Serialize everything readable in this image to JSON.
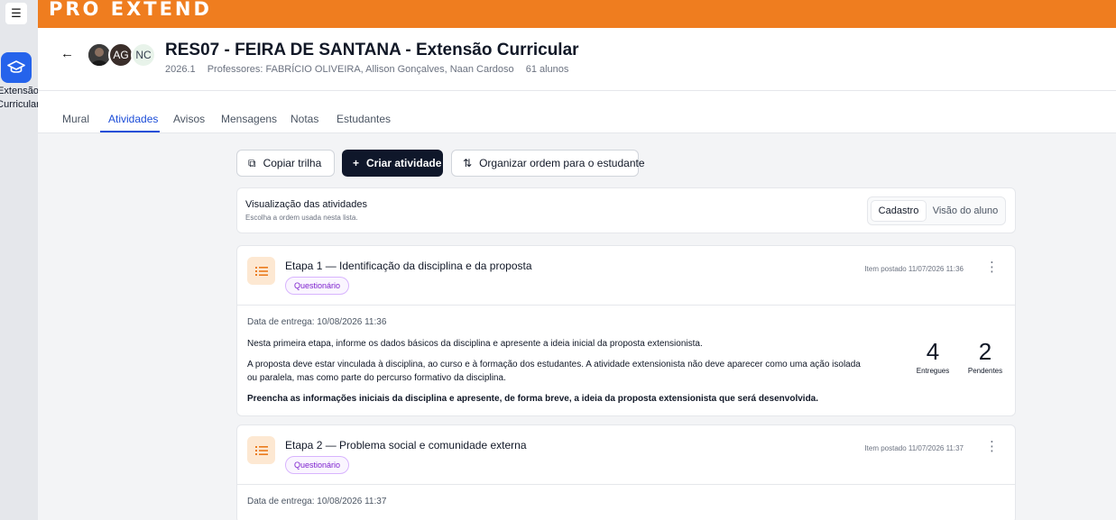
{
  "brand": {
    "name": "PRO EXTEND"
  },
  "rail": {
    "menu_icon": "hamburger-icon",
    "app_icon": "graduation-cap-icon",
    "app_label": "Extensão Curricular"
  },
  "course": {
    "title": "RES07 - FEIRA DE SANTANA - Extensão Curricular",
    "term": "2026.1",
    "professors": "Professores: FABRÍCIO OLIVEIRA, Allison Gonçalves, Naan Cardoso",
    "students": "61 alunos",
    "avatars": [
      "",
      "AG",
      "NC"
    ]
  },
  "tabs": [
    {
      "label": "Mural"
    },
    {
      "label": "Atividades",
      "active": true
    },
    {
      "label": "Avisos"
    },
    {
      "label": "Mensagens"
    },
    {
      "label": "Notas"
    },
    {
      "label": "Estudantes"
    }
  ],
  "toolbar": {
    "copy_label": "Copiar trilha",
    "create_label": "Criar atividade",
    "organize_label": "Organizar ordem para o estudante"
  },
  "view": {
    "title": "Visualização das atividades",
    "subtitle": "Escolha a ordem usada nesta lista.",
    "options": [
      "Cadastro",
      "Visão do aluno"
    ],
    "selected": "Cadastro"
  },
  "activities": [
    {
      "title": "Etapa 1 — Identificação da disciplina e da proposta",
      "badge": "Questionário",
      "posted": "Item postado 11/07/2026 11:36",
      "due": "Data de entrega: 10/08/2026 11:36",
      "desc1": "Nesta primeira etapa, informe os dados básicos da disciplina e apresente a ideia inicial da proposta extensionista.",
      "desc2": "A proposta deve estar vinculada à disciplina, ao curso e à formação dos estudantes. A atividade extensionista não deve aparecer como uma ação isolada ou paralela, mas como parte do percurso formativo da disciplina.",
      "desc3": "Preencha as informações iniciais da disciplina e apresente, de forma breve, a ideia da proposta extensionista que será desenvolvida.",
      "delivered": "4",
      "delivered_label": "Entregues",
      "pending": "2",
      "pending_label": "Pendentes"
    },
    {
      "title": "Etapa 2 — Problema social e comunidade externa",
      "badge": "Questionário",
      "posted": "Item postado 11/07/2026 11:37",
      "due": "Data de entrega: 10/08/2026 11:37"
    }
  ],
  "colors": {
    "brand": "#ef7d1f",
    "primary": "#2563eb",
    "dark_button": "#0f172a",
    "badge": "#7e22ce"
  }
}
